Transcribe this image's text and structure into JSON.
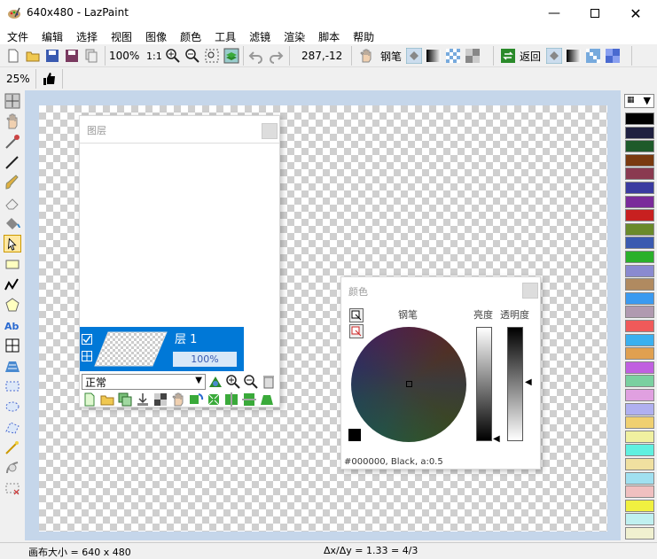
{
  "window": {
    "title": "640x480 - LazPaint"
  },
  "menu": [
    "文件",
    "编辑",
    "选择",
    "视图",
    "图像",
    "颜色",
    "工具",
    "滤镜",
    "渲染",
    "脚本",
    "帮助"
  ],
  "toolbar": {
    "zoom": "100%",
    "ratio": "1:1",
    "coords": "287,-12",
    "pen_label": "钢笔",
    "back_label": "返回"
  },
  "toolbar2": {
    "zoom_small": "25%"
  },
  "layers_panel": {
    "title": "图层",
    "layer_name": "层 1",
    "opacity": "100%",
    "blend_mode": "正常"
  },
  "color_panel": {
    "title": "颜色",
    "pen_label": "钢笔",
    "brightness_label": "亮度",
    "alpha_label": "透明度",
    "color_info": "#000000, Black, a:0.5"
  },
  "palette_colors": [
    "#000000",
    "#1f2040",
    "#1e5a2a",
    "#7a3a10",
    "#8a3a50",
    "#3a3aa0",
    "#7a2a9a",
    "#c82020",
    "#6a8a2a",
    "#3a5ab0",
    "#2ab02a",
    "#8a8ad0",
    "#b08a60",
    "#3a9af0",
    "#b09ab0",
    "#f05a5a",
    "#3ab0f0",
    "#e0a050",
    "#c060e0",
    "#7ad0a0",
    "#e0a0e0",
    "#b0b0f0",
    "#f0d070",
    "#f0f0a0",
    "#60f0e0",
    "#f0e0a0",
    "#a0e0f0",
    "#f0c0c0",
    "#f0f040",
    "#c0f0f0",
    "#f0f0d0"
  ],
  "status": {
    "canvas_size": "画布大小 = 640 x 480",
    "ratio": "Δx/Δy = 1.33 = 4/3"
  }
}
